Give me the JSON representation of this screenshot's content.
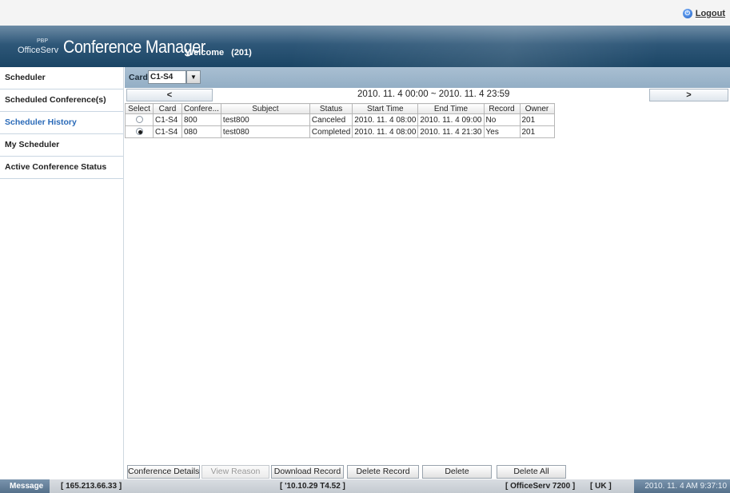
{
  "topbar": {
    "logout_label": "Logout"
  },
  "header": {
    "logo_small": "PBP",
    "logo": "OfficeServ",
    "title": "Conference Manager",
    "welcome": "Welcome",
    "user": "(201)"
  },
  "sidebar": {
    "items": [
      {
        "label": "Scheduler"
      },
      {
        "label": "Scheduled Conference(s)"
      },
      {
        "label": "Scheduler History"
      },
      {
        "label": "My Scheduler"
      },
      {
        "label": "Active Conference Status"
      }
    ]
  },
  "cardbar": {
    "label": "Card",
    "selected": "C1-S4"
  },
  "datenav": {
    "prev_label": "<",
    "next_label": ">",
    "range": "2010. 11. 4 00:00  ~  2010. 11. 4 23:59"
  },
  "table": {
    "headers": [
      "Select",
      "Card",
      "Confere...",
      "Subject",
      "Status",
      "Start Time",
      "End Time",
      "Record",
      "Owner"
    ],
    "rows": [
      {
        "selected": false,
        "card": "C1-S4",
        "conf": "800",
        "subject": "test800",
        "status": "Canceled",
        "start": "2010. 11. 4 08:00",
        "end": "2010. 11. 4 09:00",
        "record": "No",
        "owner": "201"
      },
      {
        "selected": true,
        "card": "C1-S4",
        "conf": "080",
        "subject": "test080",
        "status": "Completed",
        "start": "2010. 11. 4 08:00",
        "end": "2010. 11. 4 21:30",
        "record": "Yes",
        "owner": "201"
      }
    ]
  },
  "buttons": {
    "details": "Conference Details",
    "view_reason": "View Reason",
    "download": "Download Record",
    "delete_record": "Delete Record",
    "delete": "Delete",
    "delete_all": "Delete All"
  },
  "status": {
    "message_label": "Message",
    "ip": "[ 165.213.66.33 ]",
    "version": "[ '10.10.29 T4.52 ]",
    "system": "[ OfficeServ 7200 ]",
    "locale": "[ UK ]",
    "clock": "2010. 11. 4 AM 9:37:10"
  }
}
